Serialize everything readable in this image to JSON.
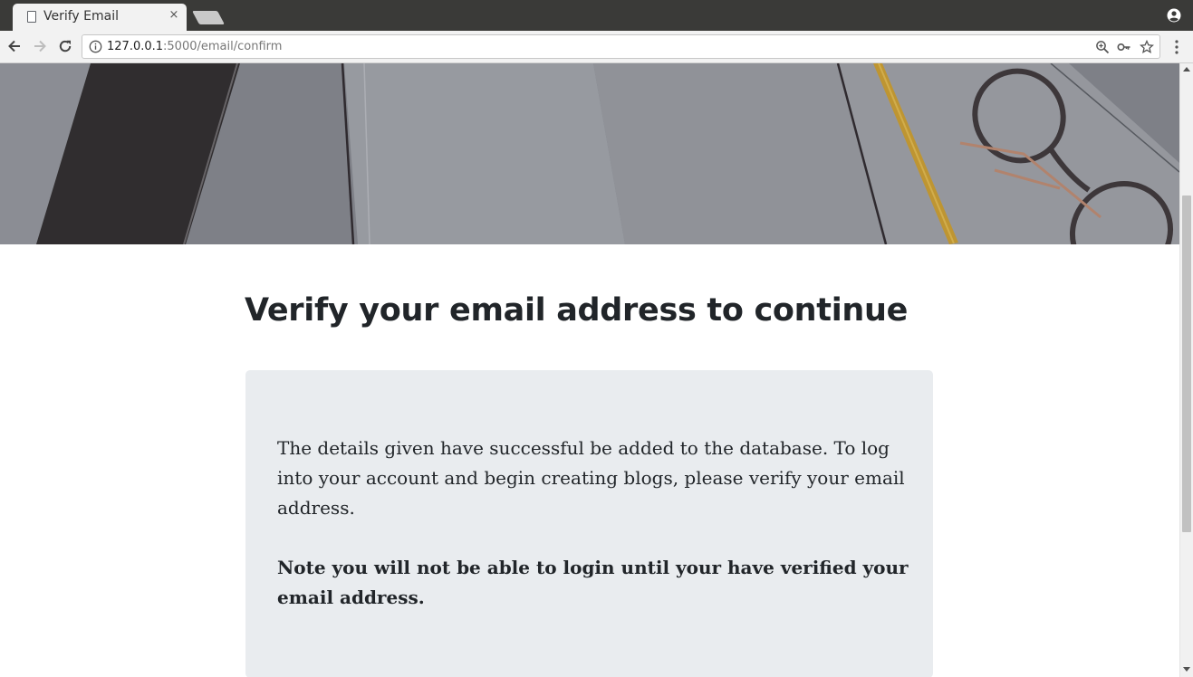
{
  "browser": {
    "tab": {
      "title": "Verify Email",
      "close_glyph": "×"
    },
    "address_bar": {
      "host": "127.0.0.1",
      "path": ":5000/email/confirm"
    },
    "icons": [
      "page-icon",
      "close-icon",
      "profile-icon",
      "back-arrow-icon",
      "forward-arrow-icon",
      "reload-icon",
      "info-icon",
      "zoom-icon",
      "key-icon",
      "star-icon",
      "menu-icon"
    ]
  },
  "page": {
    "heading": "Verify your email address to continue",
    "notice": {
      "message": "The details given have successful be added to the database. To log into your account and begin creating blogs, please verify your email address.",
      "note": "Note you will not be able to login until your have verified your email address."
    }
  },
  "colors": {
    "card_bg": "#e9ecef",
    "text": "#212529",
    "chrome_dark": "#3a3a38",
    "toolbar": "#f2f2f2"
  }
}
